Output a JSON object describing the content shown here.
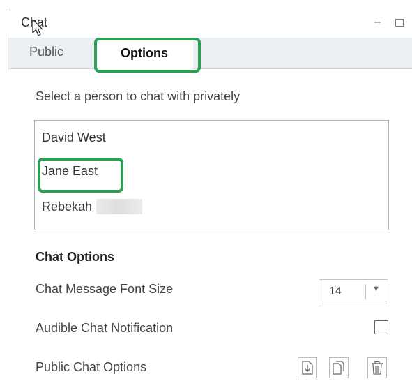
{
  "window": {
    "title": "Chat",
    "controls": {
      "minimize_icon": "minimize-icon",
      "maximize_icon": "maximize-icon"
    }
  },
  "tabs": [
    {
      "label": "Public",
      "active": false
    },
    {
      "label": "Options",
      "active": true
    }
  ],
  "private_chat": {
    "prompt": "Select a person to chat with privately",
    "people": [
      "David West",
      "Jane East",
      "Rebekah"
    ],
    "highlighted": "Jane East"
  },
  "chat_options": {
    "heading": "Chat Options",
    "font_size": {
      "label": "Chat Message Font Size",
      "value": "14"
    },
    "audible": {
      "label": "Audible Chat Notification",
      "checked": false
    },
    "public_options": {
      "label": "Public Chat Options",
      "icons": [
        "save-icon",
        "copy-icon",
        "trash-icon"
      ]
    }
  },
  "colors": {
    "highlight": "#2e9e56",
    "tabbar_bg": "#eceff2",
    "border": "#b3b3b3"
  }
}
